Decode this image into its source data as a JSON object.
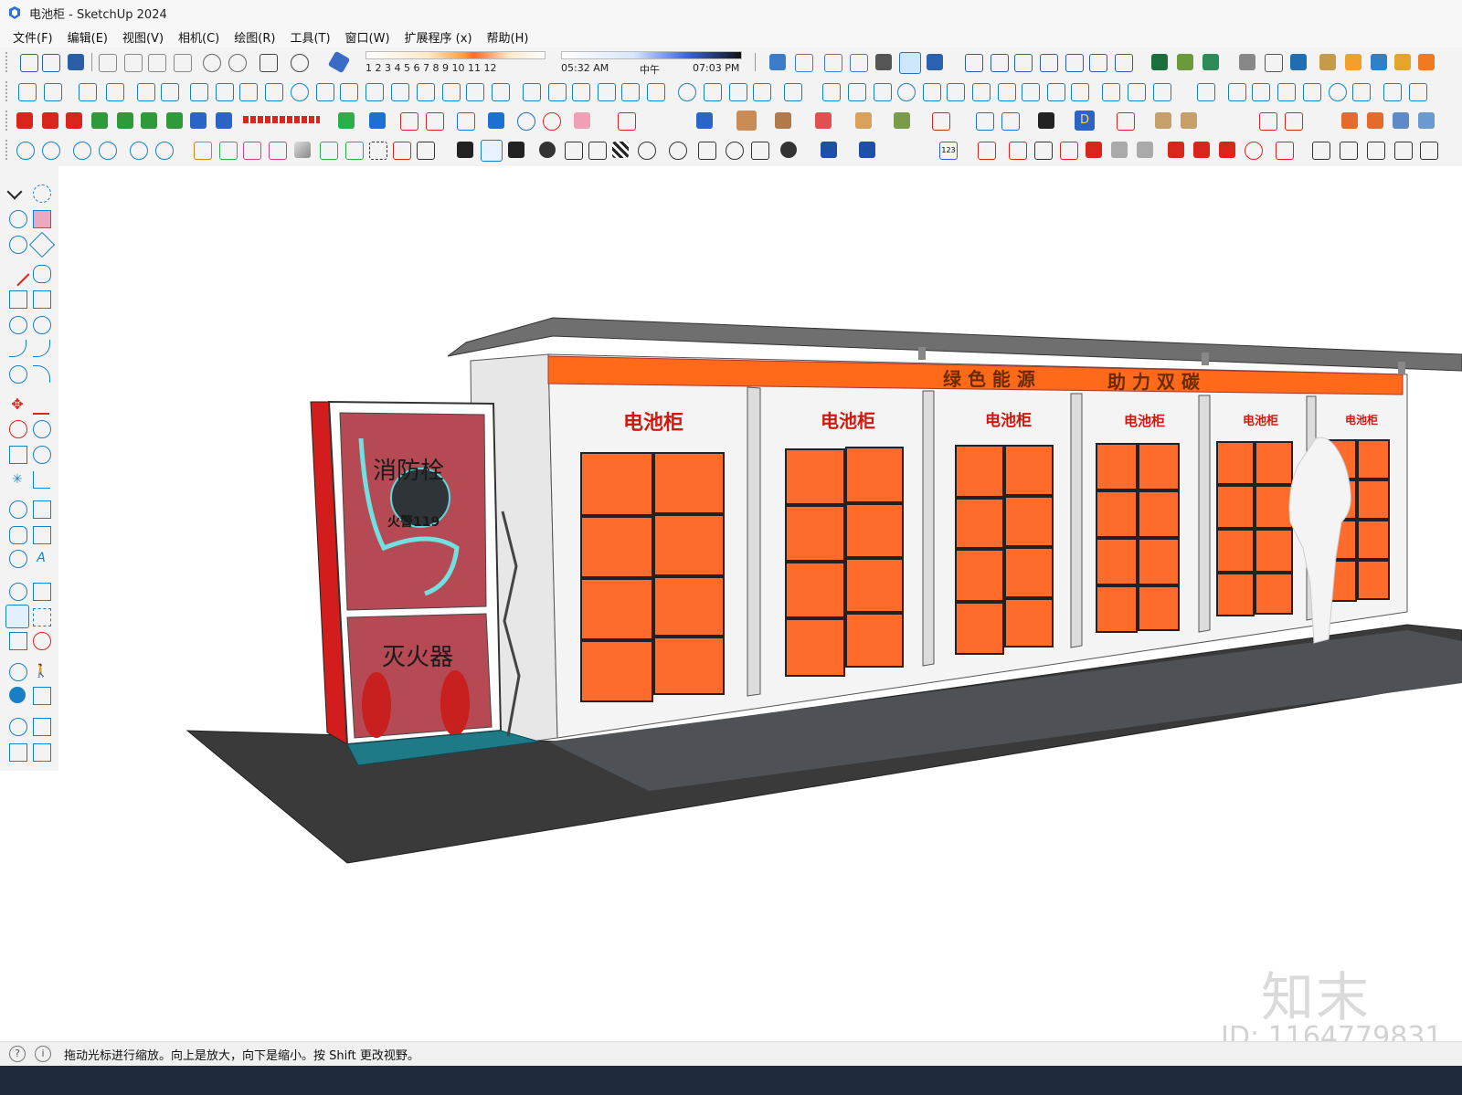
{
  "window": {
    "title": "电池柜 - SketchUp 2024"
  },
  "menu": [
    "文件(F)",
    "编辑(E)",
    "视图(V)",
    "相机(C)",
    "绘图(R)",
    "工具(T)",
    "窗口(W)",
    "扩展程序 (x)",
    "帮助(H)"
  ],
  "shadow": {
    "months": "1 2 3 4 5 6 7 8 9 10 11 12",
    "time_start": "05:32 AM",
    "time_mid": "中午",
    "time_end": "07:03 PM"
  },
  "model": {
    "banner_left": "绿 色 能 源",
    "banner_right": "助 力 双 碳",
    "cabinet_label": "电池柜",
    "hydrant_label": "消防栓",
    "fire_phone": "火警119",
    "extinguisher_label": "灭火器"
  },
  "status": {
    "hint": "拖动光标进行缩放。向上是放大，向下是缩小。按 Shift 更改视野。"
  },
  "watermark": {
    "brand": "知末",
    "id": "ID: 1164779831"
  },
  "colors": {
    "accent_orange": "#ff6a1a",
    "panel_orange": "#ff6b2a",
    "frame_red": "#d31d1d",
    "floor_dark": "#3c3c3c",
    "teal_icon": "#1a9bb0"
  }
}
